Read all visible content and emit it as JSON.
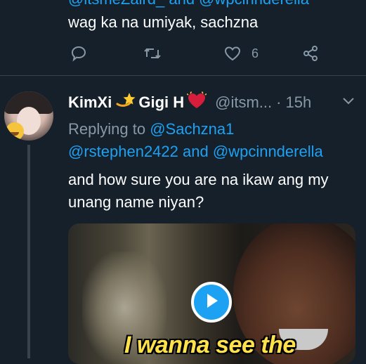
{
  "prev_tweet": {
    "handles_partial": "@itsmeZaird_ and @wpcinnderella",
    "text": "wag ka na umiyak, sachzna",
    "actions": {
      "reply_icon": "reply-icon",
      "retweet_icon": "retweet-icon",
      "like_icon": "heart-icon",
      "like_count": "6",
      "share_icon": "share-icon"
    }
  },
  "tweet": {
    "display_name_1": "KimXi",
    "display_name_icon_1": "dizzy-star-emoji",
    "display_name_2": "Gigi H",
    "display_name_icon_2": "heart-emoji",
    "handle": "@itsm...",
    "separator": "·",
    "time": "15h",
    "replying_to_label": "Replying to",
    "reply_to_1": "@Sachzna1",
    "reply_to_2": "@rstephen2422",
    "reply_and": "and",
    "reply_to_3": "@wpcinnderella",
    "text": "and how sure you are  na ikaw ang my unang name niyan?",
    "media": {
      "caption": "I wanna see the",
      "play_icon": "play-icon"
    }
  },
  "colors": {
    "background": "#15202b",
    "accent": "#1da1f2",
    "muted": "#8899a6",
    "divider": "#38444d",
    "like": "#e0245e"
  }
}
